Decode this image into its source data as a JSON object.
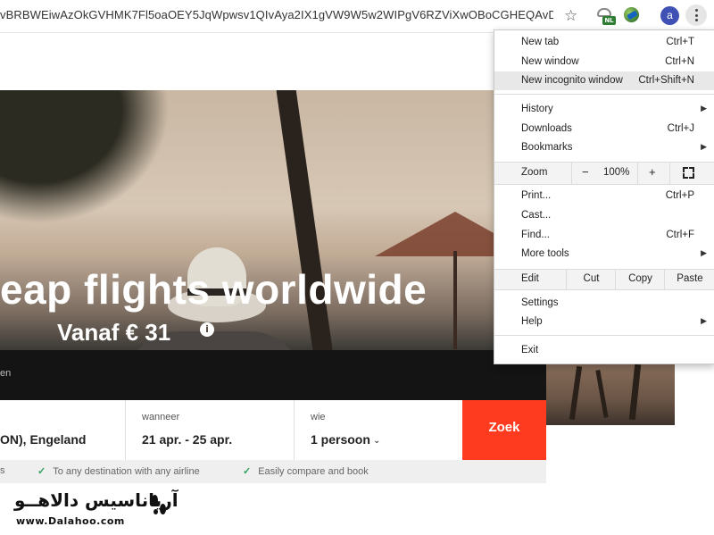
{
  "browser": {
    "url": "vBRBWEiwAzOkGVHMK7Fl5oaOEY5JqWpwsv1QIvAya2IX1gVW9W5w2WIPgV6RZViXwOBoCGHEQAvD_BwE",
    "star_icon": "bookmark-star-icon",
    "extensions": [
      {
        "name": "translate-nl-extension-icon",
        "badge": "NL"
      },
      {
        "name": "globe-extension-icon"
      }
    ],
    "profile_initial": "a",
    "profile_color": "#3f51b5"
  },
  "hero": {
    "headline": "eap flights worldwide",
    "subline": "Vanaf € 31",
    "info_symbol": "i"
  },
  "dark_strip": {
    "text": "en"
  },
  "search": {
    "destination_value": "ON), Engeland",
    "date_label": "wanneer",
    "date_value": "21 apr. - 25 apr.",
    "who_label": "wie",
    "who_value": "1 persoon",
    "submit_label": "Zoek",
    "accent_color": "#ff3b1f"
  },
  "benefits": [
    {
      "text": "s"
    },
    {
      "text": "To any destination with any airline"
    },
    {
      "text": "Easily compare and book"
    }
  ],
  "watermark": {
    "arabic": "آریاناسیس دالاهــو",
    "latin": "www.Dalahoo.com"
  },
  "menu": {
    "new_tab": {
      "label": "New tab",
      "shortcut": "Ctrl+T"
    },
    "new_window": {
      "label": "New window",
      "shortcut": "Ctrl+N"
    },
    "new_incognito": {
      "label": "New incognito window",
      "shortcut": "Ctrl+Shift+N"
    },
    "history": {
      "label": "History"
    },
    "downloads": {
      "label": "Downloads",
      "shortcut": "Ctrl+J"
    },
    "bookmarks": {
      "label": "Bookmarks"
    },
    "zoom": {
      "label": "Zoom",
      "minus": "−",
      "value": "100%",
      "plus": "+"
    },
    "print": {
      "label": "Print...",
      "shortcut": "Ctrl+P"
    },
    "cast": {
      "label": "Cast..."
    },
    "find": {
      "label": "Find...",
      "shortcut": "Ctrl+F"
    },
    "more_tools": {
      "label": "More tools"
    },
    "edit": {
      "label": "Edit",
      "cut": "Cut",
      "copy": "Copy",
      "paste": "Paste"
    },
    "settings": {
      "label": "Settings"
    },
    "help": {
      "label": "Help"
    },
    "exit": {
      "label": "Exit"
    }
  }
}
